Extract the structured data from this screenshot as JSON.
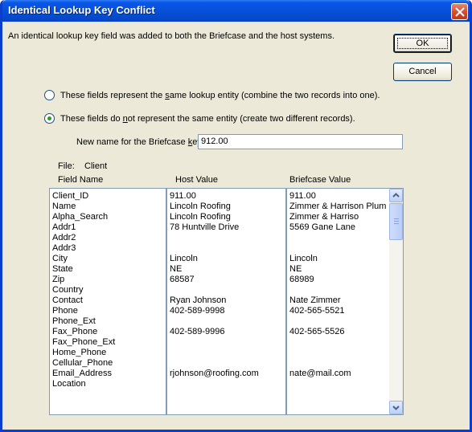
{
  "window": {
    "title": "Identical Lookup Key Conflict"
  },
  "message": "An identical lookup key field was added to both the Briefcase and the host systems.",
  "buttons": {
    "ok": "OK",
    "cancel": "Cancel"
  },
  "options": {
    "combine": {
      "prefix": "These fields represent the ",
      "accel": "s",
      "suffix": "ame lookup entity (combine the two records into one).",
      "checked": false
    },
    "separate": {
      "prefix": "These fields do ",
      "accel": "n",
      "suffix": "ot represent the same entity (create two different records).",
      "checked": true
    }
  },
  "new_name": {
    "label_prefix": "New name for the Briefcase ",
    "label_accel": "k",
    "label_suffix": "ey:",
    "value": "912.00"
  },
  "file": {
    "label": "File:",
    "value": "Client"
  },
  "table": {
    "headers": {
      "field": "Field Name",
      "host": "Host Value",
      "briefcase": "Briefcase Value"
    },
    "field_names": [
      "Client_ID",
      "Name",
      "Alpha_Search",
      "Addr1",
      "Addr2",
      "Addr3",
      "City",
      "State",
      "Zip",
      "Country",
      "Contact",
      "Phone",
      "Phone_Ext",
      "Fax_Phone",
      "Fax_Phone_Ext",
      "Home_Phone",
      "Cellular_Phone",
      "Email_Address",
      "Location"
    ],
    "host_values": [
      "     911.00",
      "Lincoln Roofing",
      "Lincoln Roofing",
      "78 Huntville Drive",
      "",
      "",
      "Lincoln",
      "NE",
      "68587",
      "",
      "Ryan Johnson",
      "402-589-9998",
      "",
      "402-589-9996",
      "",
      "",
      "",
      "rjohnson@roofing.com",
      ""
    ],
    "briefcase_values": [
      "     911.00",
      "Zimmer & Harrison Plum",
      "Zimmer & Harriso",
      "5569 Gane Lane",
      "",
      "",
      "Lincoln",
      "NE",
      "68989",
      "",
      "Nate Zimmer",
      "402-565-5521",
      "",
      "402-565-5526",
      "",
      "",
      "",
      "nate@mail.com",
      ""
    ]
  }
}
